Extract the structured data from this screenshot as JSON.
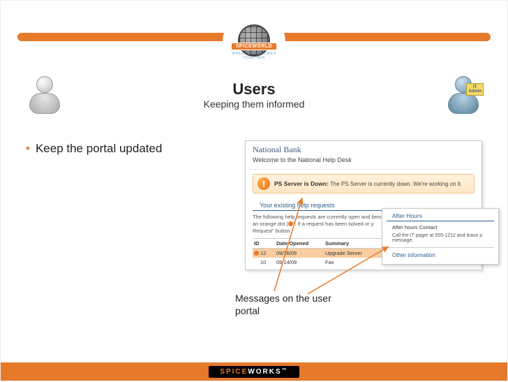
{
  "logo": {
    "brand": "SPICEWORLD",
    "tagline": "WHERE IT ALL COMES TOGETHER"
  },
  "title": "Users",
  "subtitle": "Keeping them informed",
  "bullet": "Keep the portal updated",
  "it_badge": {
    "line1": "IT",
    "line2": "Admin"
  },
  "portal": {
    "brand": "National Bank",
    "welcome": "Welcome to the National Help Desk",
    "alert_title": "PS Server is Down:",
    "alert_body": "The PS Server is currently down. We're working on it.",
    "section_title": "Your existing help requests",
    "section_desc_a": "The following help requests are currently open and being",
    "section_desc_b": ". If a request has been solved or y",
    "section_desc_c": "an orange dot (",
    "section_desc_d": "Request\" button.",
    "columns": {
      "id": "ID",
      "date": "Date Opened",
      "summary": "Summary"
    },
    "rows": [
      {
        "id": "12",
        "date": "09/16/09",
        "summary": "Upgrade Server",
        "highlight": true,
        "dot": true
      },
      {
        "id": "10",
        "date": "09/14/09",
        "summary": "Fax",
        "highlight": false,
        "dot": false
      }
    ]
  },
  "popup": {
    "head": "After Hours",
    "subhead": "After hours Contact",
    "text": "Call the IT pager at 555-1212 and leave a message.",
    "head2": "Other information"
  },
  "callout": "Messages on the user portal",
  "footer": {
    "part1": "SPICE",
    "part2": "WORKS",
    "tm": "™"
  }
}
